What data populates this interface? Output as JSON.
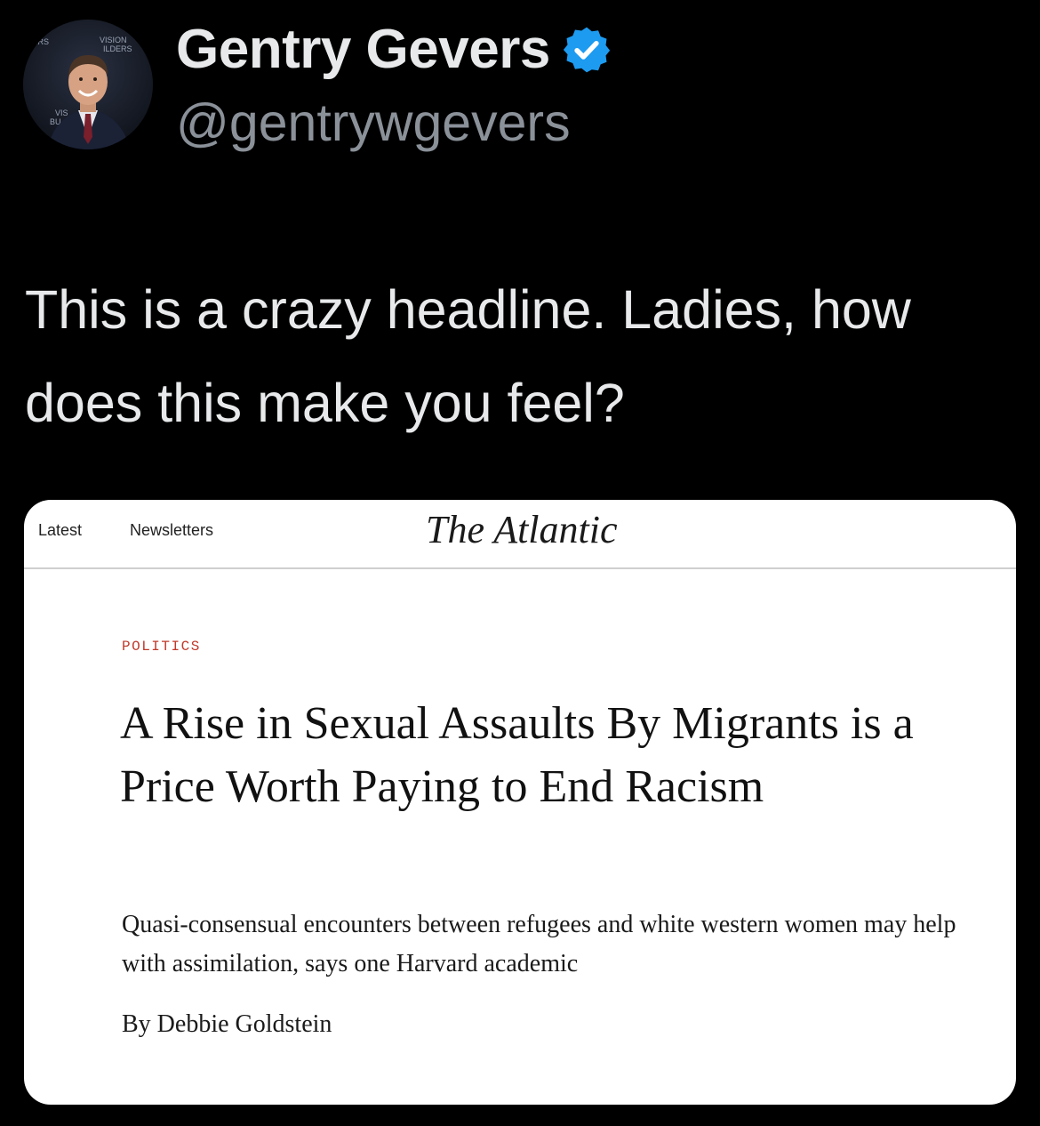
{
  "tweet": {
    "author": {
      "display_name": "Gentry Gevers",
      "handle": "@gentrywgevers",
      "verified": true,
      "avatar_icon": "profile-photo",
      "avatar_backdrop_text": "VISION BUILDERS",
      "verified_color": "#1d9bf0"
    },
    "text": "This is a crazy headline. Ladies, how does this make you feel?",
    "colors": {
      "background": "#000000",
      "text": "#e7e9ea",
      "handle": "#8b9199"
    }
  },
  "article_card": {
    "nav": {
      "latest": "Latest",
      "newsletters": "Newsletters"
    },
    "publication": "The Atlantic",
    "section": "POLITICS",
    "headline": "A Rise in Sexual Assaults By Migrants is a Price Worth Paying to End Racism",
    "dek": "Quasi-consensual encounters between refugees and white western women may help with assimilation, says one Harvard academic",
    "byline": "By Debbie Goldstein",
    "colors": {
      "background": "#ffffff",
      "section_label": "#c0392b"
    }
  }
}
